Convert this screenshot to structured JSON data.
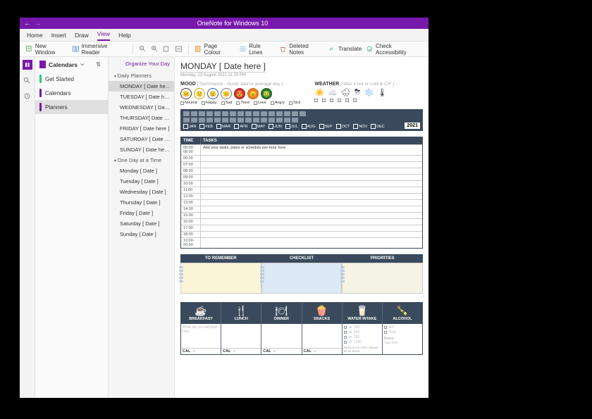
{
  "app": {
    "title": "OneNote for Windows 10"
  },
  "menu": {
    "tabs": [
      "Home",
      "Insert",
      "Draw",
      "View",
      "Help"
    ],
    "active": 3
  },
  "ribbon": {
    "new_window": "New Window",
    "immersive": "Immersive Reader",
    "page_colour": "Page Colour",
    "rule_lines": "Rule Lines",
    "deleted": "Deleted Notes",
    "translate": "Translate",
    "accessibility": "Check Accessibility"
  },
  "notebook": {
    "current": "Calendars",
    "sections": [
      {
        "label": "Get Started",
        "color": "#2ecc71"
      },
      {
        "label": "Calendars",
        "color": "#7719aa"
      },
      {
        "label": "Planners",
        "color": "#7719aa",
        "selected": true
      }
    ]
  },
  "pages": {
    "header": "Organize Your Day",
    "groups": [
      {
        "name": "Daily Planners",
        "pages": [
          "MONDAY [ Date her...",
          "TUESDAY [ Date her...",
          "WEDNESDAY [ Date...",
          "THURSDAY[ Date he...",
          "FRIDAY [ Date here ]",
          "SATURDAY [ Date h...",
          "SUNDAY [ Date here ]"
        ],
        "selected": 0
      },
      {
        "name": "One Day at a Time",
        "pages": [
          "Monday [ Date ]",
          "Tuesday [ Date ]",
          "Wednesday [ Date ]",
          "Thursday [ Date ]",
          "Friday [ Date ]",
          "Saturday [ Date ]",
          "Sunday [ Date ]"
        ]
      }
    ]
  },
  "doc": {
    "title": "MONDAY [ Date here ]",
    "subtitle": "Monday, 23 August 2021    11:25 PM",
    "mood": {
      "label": "MOOD",
      "hint": "[ Summarize - Good, bad or average day ]",
      "options": [
        "Neutral",
        "Happy",
        "Sad",
        "Tired",
        "Love",
        "Angry",
        "Sick"
      ]
    },
    "weather": {
      "label": "WEATHER",
      "hint": "[ Was it hot or cold & C/F ]"
    },
    "months": [
      "JAN",
      "FEB",
      "MAR",
      "APR",
      "MAY",
      "JUN",
      "JUL",
      "AUG",
      "SEP",
      "OCT",
      "NOV",
      "DEC"
    ],
    "year": "2021",
    "sched": {
      "head_time": "TIME",
      "head_tasks": "TASKS",
      "hint": "Add your tasks, plans or schedule per-hour here",
      "rows": [
        "05:00- 06:00",
        "06:00",
        "07:00",
        "08:00",
        "09:00",
        "10:00",
        "11:00",
        "12:00",
        "13:00",
        "14:00",
        "15:00",
        "16:00",
        "17:00",
        "18:00",
        "19:00- 20:00"
      ]
    },
    "triple": {
      "a": "TO REMEMBER",
      "b": "CHECKLIST",
      "c": "PRIORITIES"
    },
    "meals": {
      "cols": [
        {
          "name": "BREAKFAST",
          "icon": "☕",
          "footer": "CAL    --"
        },
        {
          "name": "LUNCH",
          "icon": "🍴",
          "footer": "CAL    --"
        },
        {
          "name": "DINNER",
          "icon": "🍽",
          "footer": "CAL    --"
        },
        {
          "name": "SNACKS",
          "icon": "🍿",
          "footer": "CAL    --"
        },
        {
          "name": "WATER INTAKE",
          "icon": "🥛"
        },
        {
          "name": "ALCOHOL",
          "icon": "🍾"
        }
      ],
      "hint": "What did you eat/drink here",
      "water_amounts": [
        "250",
        "500",
        "750",
        "1000"
      ],
      "water_note": "Need more rows, please let us know",
      "alc_opts": [
        "NO",
        "YES"
      ],
      "alc_notes": "Notes"
    }
  }
}
